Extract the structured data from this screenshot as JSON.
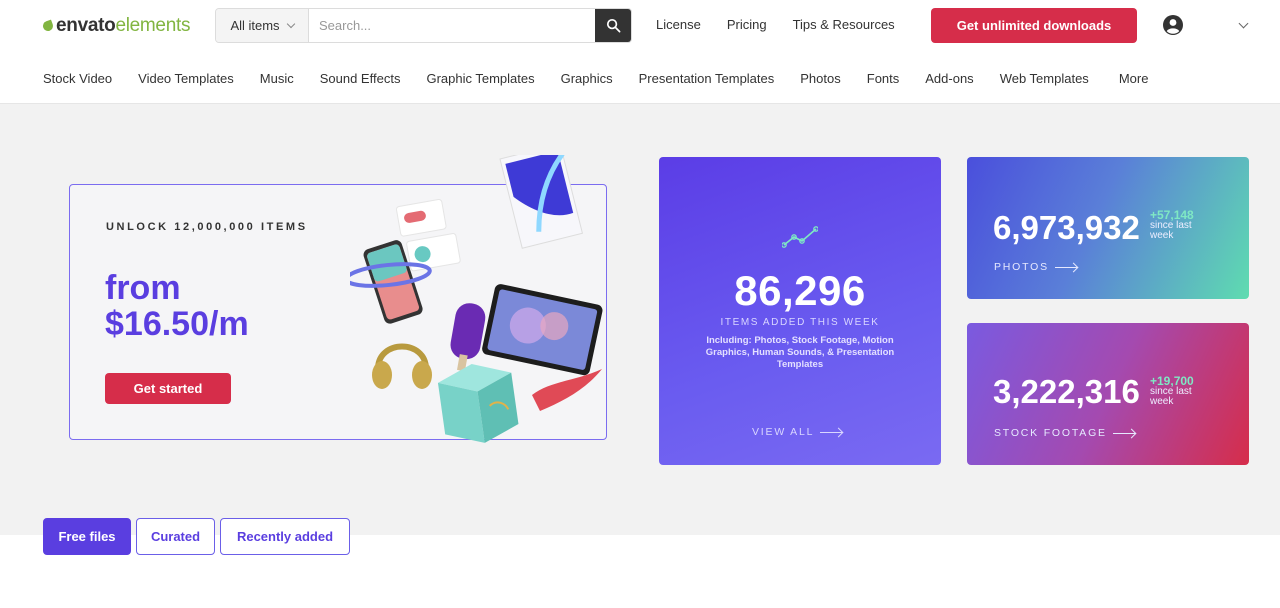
{
  "header": {
    "logo": {
      "part_a": "envato",
      "part_b": "elements"
    },
    "search": {
      "category": "All items",
      "placeholder": "Search..."
    },
    "links": [
      "License",
      "Pricing",
      "Tips & Resources"
    ],
    "cta": "Get unlimited downloads"
  },
  "nav": [
    "Stock Video",
    "Video Templates",
    "Music",
    "Sound Effects",
    "Graphic Templates",
    "Graphics",
    "Presentation Templates",
    "Photos",
    "Fonts",
    "Add-ons",
    "Web Templates",
    "More"
  ],
  "promo": {
    "kicker": "UNLOCK 12,000,000 ITEMS",
    "price_line1": "from",
    "price_line2": "$16.50/m",
    "button": "Get started"
  },
  "weekly": {
    "number": "86,296",
    "label": "ITEMS ADDED THIS WEEK",
    "including": "Including: Photos, Stock Footage, Motion Graphics, Human Sounds, & Presentation Templates",
    "view_all": "VIEW ALL"
  },
  "stats": {
    "photos": {
      "number": "6,973,932",
      "delta": "+57,148",
      "since": "since last week",
      "link": "PHOTOS"
    },
    "footage": {
      "number": "3,222,316",
      "delta": "+19,700",
      "since": "since last week",
      "link": "STOCK FOOTAGE"
    }
  },
  "tabs": [
    "Free files",
    "Curated",
    "Recently added"
  ],
  "colors": {
    "brand_green": "#82b541",
    "accent_red": "#d62d4a",
    "accent_purple": "#5a3ee0"
  }
}
